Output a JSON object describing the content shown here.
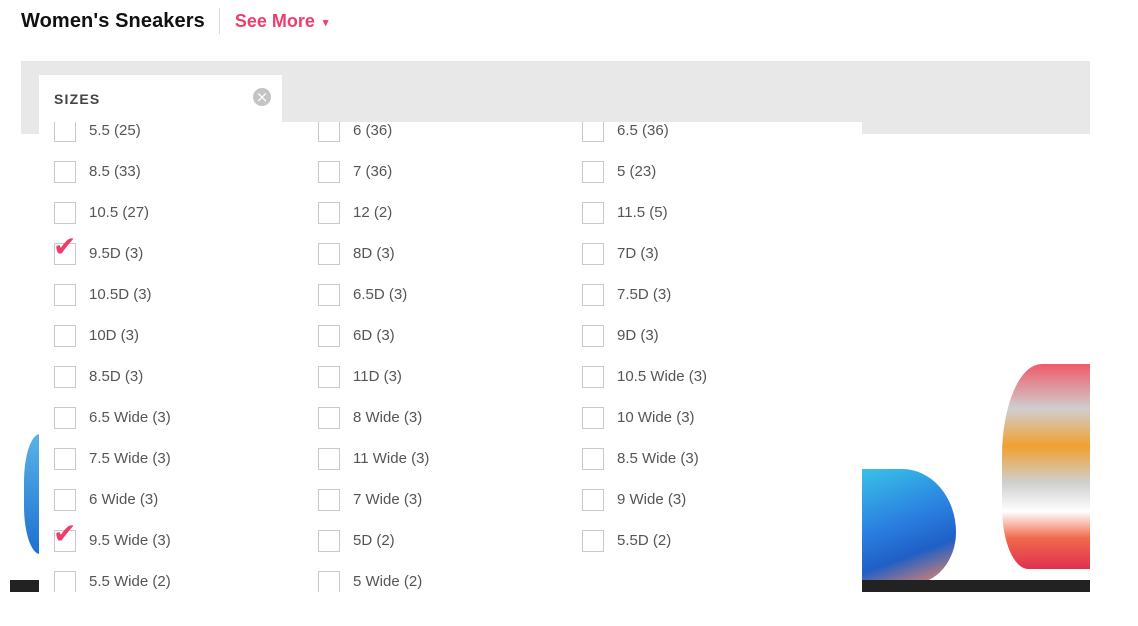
{
  "header": {
    "title": "Women's Sneakers",
    "see_more_label": "See More",
    "see_more_caret": "▾"
  },
  "filter": {
    "tab_label": "SIZES",
    "close_glyph": "×"
  },
  "colors": {
    "accent": "#ee3d6a",
    "filter_bar_bg": "#e8e8e8"
  },
  "sizes": [
    {
      "label": "5.5 (25)",
      "checked": false
    },
    {
      "label": "6 (36)",
      "checked": false
    },
    {
      "label": "6.5 (36)",
      "checked": false
    },
    {
      "label": "8.5 (33)",
      "checked": false
    },
    {
      "label": "7 (36)",
      "checked": false
    },
    {
      "label": "5 (23)",
      "checked": false
    },
    {
      "label": "10.5 (27)",
      "checked": false
    },
    {
      "label": "12 (2)",
      "checked": false
    },
    {
      "label": "11.5 (5)",
      "checked": false
    },
    {
      "label": "9.5D (3)",
      "checked": true
    },
    {
      "label": "8D (3)",
      "checked": false
    },
    {
      "label": "7D (3)",
      "checked": false
    },
    {
      "label": "10.5D (3)",
      "checked": false
    },
    {
      "label": "6.5D (3)",
      "checked": false
    },
    {
      "label": "7.5D (3)",
      "checked": false
    },
    {
      "label": "10D (3)",
      "checked": false
    },
    {
      "label": "6D (3)",
      "checked": false
    },
    {
      "label": "9D (3)",
      "checked": false
    },
    {
      "label": "8.5D (3)",
      "checked": false
    },
    {
      "label": "11D (3)",
      "checked": false
    },
    {
      "label": "10.5 Wide (3)",
      "checked": false
    },
    {
      "label": "6.5 Wide (3)",
      "checked": false
    },
    {
      "label": "8 Wide (3)",
      "checked": false
    },
    {
      "label": "10 Wide (3)",
      "checked": false
    },
    {
      "label": "7.5 Wide (3)",
      "checked": false
    },
    {
      "label": "11 Wide (3)",
      "checked": false
    },
    {
      "label": "8.5 Wide (3)",
      "checked": false
    },
    {
      "label": "6 Wide (3)",
      "checked": false
    },
    {
      "label": "7 Wide (3)",
      "checked": false
    },
    {
      "label": "9 Wide (3)",
      "checked": false
    },
    {
      "label": "9.5 Wide (3)",
      "checked": true
    },
    {
      "label": "5D (2)",
      "checked": false
    },
    {
      "label": "5.5D (2)",
      "checked": false
    },
    {
      "label": "5.5 Wide (2)",
      "checked": false
    },
    {
      "label": "5 Wide (2)",
      "checked": false
    }
  ]
}
